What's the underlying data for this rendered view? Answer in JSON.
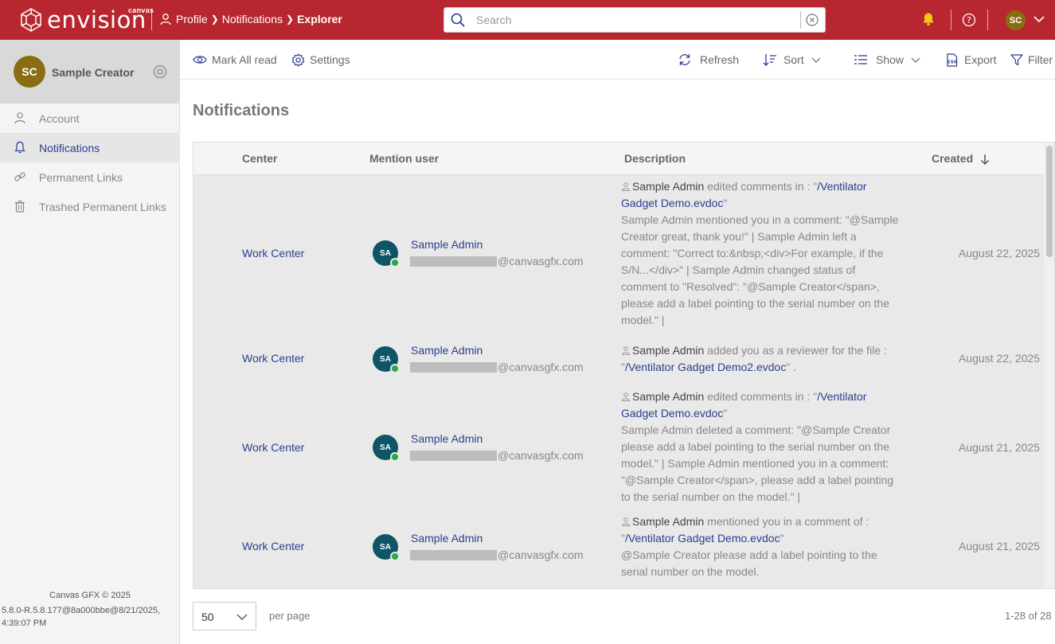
{
  "app": {
    "logo_small": "canvas",
    "logo_text": "envision",
    "colors": {
      "brand": "#b8262f",
      "link": "#2a3e8f",
      "avatar_user": "#8a6d12",
      "avatar_admin": "#0e5566",
      "online": "#28a745"
    }
  },
  "breadcrumb": [
    {
      "label": "Profile"
    },
    {
      "label": "Notifications"
    },
    {
      "label": "Explorer"
    }
  ],
  "search": {
    "placeholder": "Search"
  },
  "header": {
    "avatar_initials": "SC"
  },
  "sidebar": {
    "user": {
      "initials": "SC",
      "name": "Sample Creator"
    },
    "items": [
      {
        "label": "Account",
        "icon": "person-icon"
      },
      {
        "label": "Notifications",
        "icon": "bell-icon"
      },
      {
        "label": "Permanent Links",
        "icon": "link-icon"
      },
      {
        "label": "Trashed Permanent Links",
        "icon": "trash-icon"
      }
    ],
    "footer_copyright": "Canvas GFX © 2025",
    "footer_version": "5.8.0-R.5.8.177@8a000bbe@8/21/2025, 4:39:07 PM"
  },
  "toolbar": {
    "mark_all_read": "Mark All read",
    "settings": "Settings",
    "refresh": "Refresh",
    "sort": "Sort",
    "show": "Show",
    "export": "Export",
    "filter": "Filter"
  },
  "page": {
    "title": "Notifications"
  },
  "table": {
    "columns": {
      "center": "Center",
      "mention_user": "Mention user",
      "description": "Description",
      "created": "Created"
    },
    "rows": [
      {
        "center": "Work Center",
        "initials": "SA",
        "user_name": "Sample Admin",
        "email_domain": "@canvasgfx.com",
        "actor": "Sample Admin",
        "action": " edited comments in : \"",
        "file": "/Ventilator Gadget Demo.evdoc",
        "after_file": "\"",
        "detail": "Sample Admin mentioned you in a comment: \"@Sample Creator great, thank you!\" | Sample Admin left a comment: \"Correct to:&nbsp;<div>For example, if the S/N...</div>\" | Sample Admin changed status of comment to \"Resolved\": \"@Sample Creator</span>, please add a label pointing to the serial number on the model.\" |",
        "created": "August 22, 2025"
      },
      {
        "center": "Work Center",
        "initials": "SA",
        "user_name": "Sample Admin",
        "email_domain": "@canvasgfx.com",
        "actor": "Sample Admin",
        "action": " added you as a reviewer for the file : \"",
        "file": "/Ventilator Gadget Demo2.evdoc",
        "after_file": "\" .",
        "detail": "",
        "created": "August 22, 2025"
      },
      {
        "center": "Work Center",
        "initials": "SA",
        "user_name": "Sample Admin",
        "email_domain": "@canvasgfx.com",
        "actor": "Sample Admin",
        "action": " edited comments in : \"",
        "file": "/Ventilator Gadget Demo.evdoc",
        "after_file": "\"",
        "detail": "Sample Admin deleted a comment: \"@Sample Creator please add a label pointing to the serial number on the model.\" | Sample Admin mentioned you in a comment: \"@Sample Creator</span>, please add a label pointing to the serial number on the model.\" |",
        "created": "August 21, 2025"
      },
      {
        "center": "Work Center",
        "initials": "SA",
        "user_name": "Sample Admin",
        "email_domain": "@canvasgfx.com",
        "actor": "Sample Admin",
        "action": " mentioned you in a comment of : \"",
        "file": "/Ventilator Gadget Demo.evdoc",
        "after_file": "\"",
        "detail": "@Sample Creator please add a label pointing to the serial number on the model.",
        "created": "August 21, 2025"
      }
    ]
  },
  "pagination": {
    "per_page_value": "50",
    "per_page_label": "per page",
    "range": "1-28 of 28"
  }
}
